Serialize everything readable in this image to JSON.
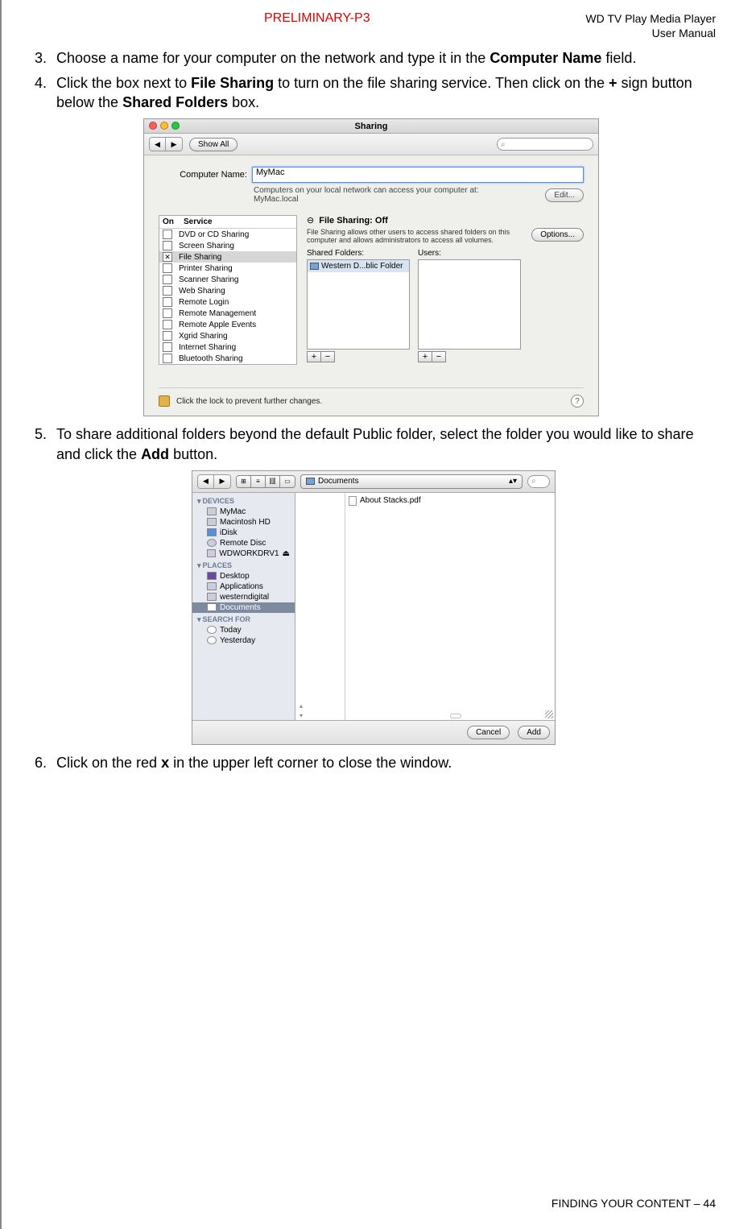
{
  "header": {
    "preliminary": "PRELIMINARY-P3",
    "doc_title_1": "WD TV Play Media Player",
    "doc_title_2": "User Manual"
  },
  "steps": {
    "s3": {
      "num": "3.",
      "a": "Choose a name for your computer on the network and type it in the ",
      "b": "Computer Name",
      "c": " field."
    },
    "s4": {
      "num": "4.",
      "a": "Click the box next to ",
      "b": "File Sharing",
      "c": " to turn on the file sharing service. Then click on the ",
      "d": "+",
      "e": " sign button below the ",
      "f": "Shared Folders",
      "g": " box."
    },
    "s5": {
      "num": "5.",
      "a": "To share additional folders beyond the default Public folder, select the folder you would like to share and click the ",
      "b": "Add",
      "c": " button."
    },
    "s6": {
      "num": "6.",
      "a": "Click on the red ",
      "b": "x",
      "c": " in the upper left corner to close the window."
    }
  },
  "sharing": {
    "title": "Sharing",
    "show_all": "Show All",
    "search_glyph": "⌕",
    "computer_name_label": "Computer Name:",
    "computer_name_value": "MyMac",
    "access_text": "Computers on your local network can access your computer at:",
    "access_host": "MyMac.local",
    "edit": "Edit...",
    "on": "On",
    "service": "Service",
    "services": [
      {
        "label": "DVD or CD Sharing",
        "checked": false,
        "selected": false
      },
      {
        "label": "Screen Sharing",
        "checked": false,
        "selected": false
      },
      {
        "label": "File Sharing",
        "checked": true,
        "selected": true
      },
      {
        "label": "Printer Sharing",
        "checked": false,
        "selected": false
      },
      {
        "label": "Scanner Sharing",
        "checked": false,
        "selected": false
      },
      {
        "label": "Web Sharing",
        "checked": false,
        "selected": false
      },
      {
        "label": "Remote Login",
        "checked": false,
        "selected": false
      },
      {
        "label": "Remote Management",
        "checked": false,
        "selected": false
      },
      {
        "label": "Remote Apple Events",
        "checked": false,
        "selected": false
      },
      {
        "label": "Xgrid Sharing",
        "checked": false,
        "selected": false
      },
      {
        "label": "Internet Sharing",
        "checked": false,
        "selected": false
      },
      {
        "label": "Bluetooth Sharing",
        "checked": false,
        "selected": false
      }
    ],
    "status_dot": "⊖",
    "fs_status": "File Sharing: Off",
    "fs_desc": "File Sharing allows other users to access shared folders on this computer and allows administrators to access all volumes.",
    "options": "Options...",
    "shared_folders": "Shared Folders:",
    "users": "Users:",
    "shared_item": "Western D...blic Folder",
    "plus": "+",
    "minus": "−",
    "lock_text": "Click the lock to prevent further changes.",
    "help": "?"
  },
  "finder": {
    "back": "◀",
    "fwd": "▶",
    "view_icons": "⊞",
    "view_list": "≡",
    "view_col": "⫿⫿⫿",
    "view_cover": "▭",
    "path_label": "Documents",
    "path_arrows": "▴▾",
    "search_glyph": "⌕",
    "devices": "DEVICES",
    "dev_items": [
      "MyMac",
      "Macintosh HD",
      "iDisk",
      "Remote Disc",
      "WDWORKDRV1"
    ],
    "eject": "⏏",
    "places": "PLACES",
    "place_items": [
      "Desktop",
      "Applications",
      "westerndigital",
      "Documents"
    ],
    "search_for": "SEARCH FOR",
    "search_items": [
      "Today",
      "Yesterday"
    ],
    "tri_down": "▾",
    "tri_up": "▴",
    "file_item": "About Stacks.pdf",
    "cancel": "Cancel",
    "add": "Add"
  },
  "footer": "FINDING YOUR CONTENT – 44"
}
